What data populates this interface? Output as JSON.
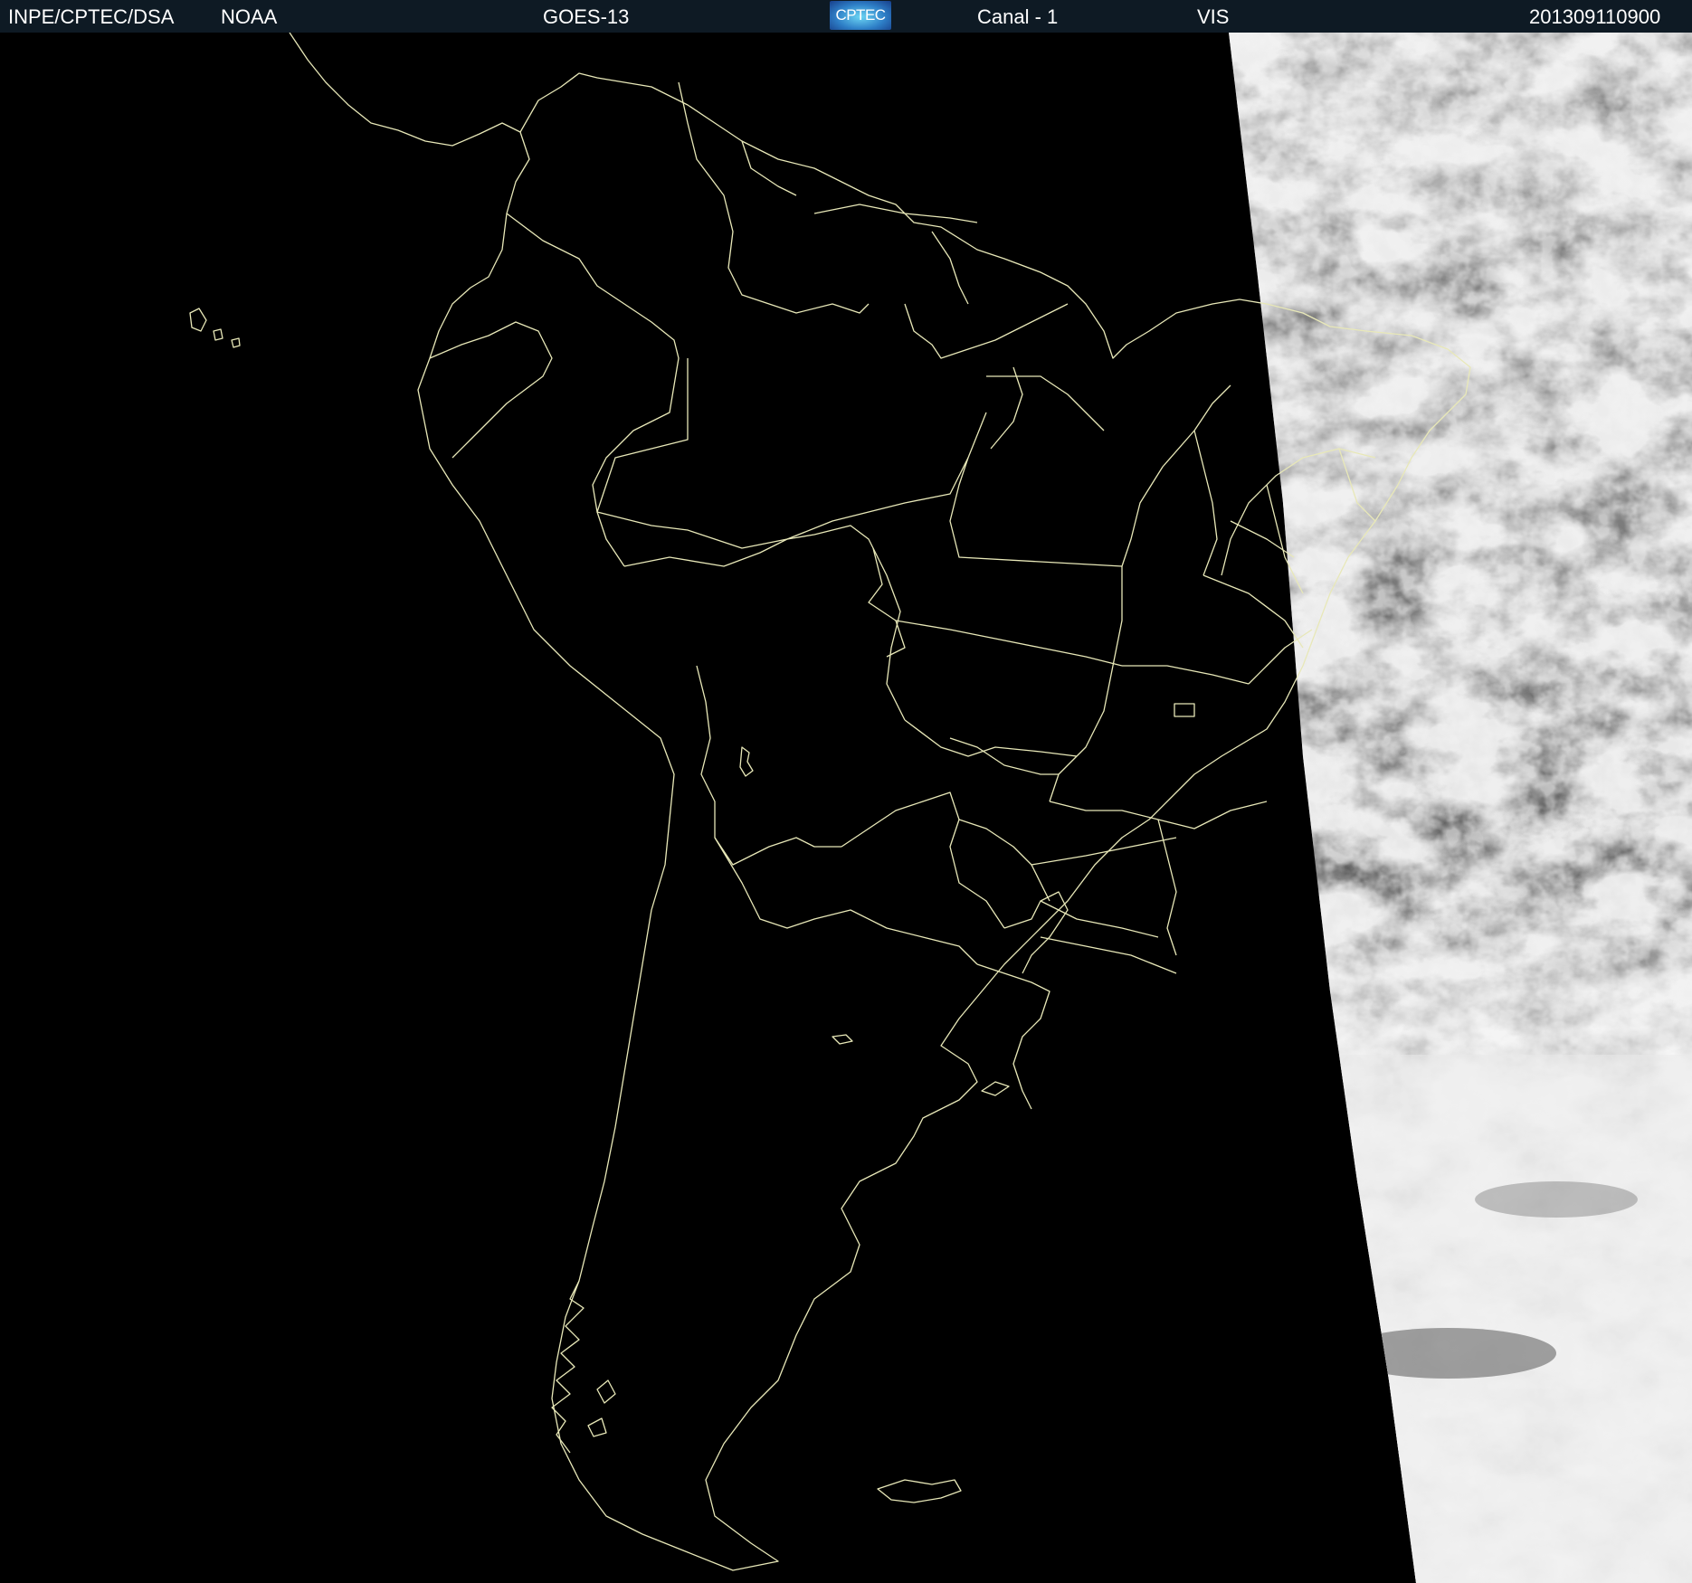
{
  "header": {
    "org": "INPE/CPTEC/DSA",
    "agency": "NOAA",
    "satellite": "GOES-13",
    "logo_text": "CPTEC",
    "channel": "Canal - 1",
    "band": "VIS",
    "timestamp": "201309110900"
  },
  "colors": {
    "header_bg": "#0e1a24",
    "background": "#000000",
    "outline": "#e8e8b8",
    "cloud_light": "#e4e4e4",
    "cloud_dark": "#6e6e6e"
  },
  "map": {
    "region": "South America",
    "image_type": "satellite visible channel",
    "terminator_side": "east"
  }
}
